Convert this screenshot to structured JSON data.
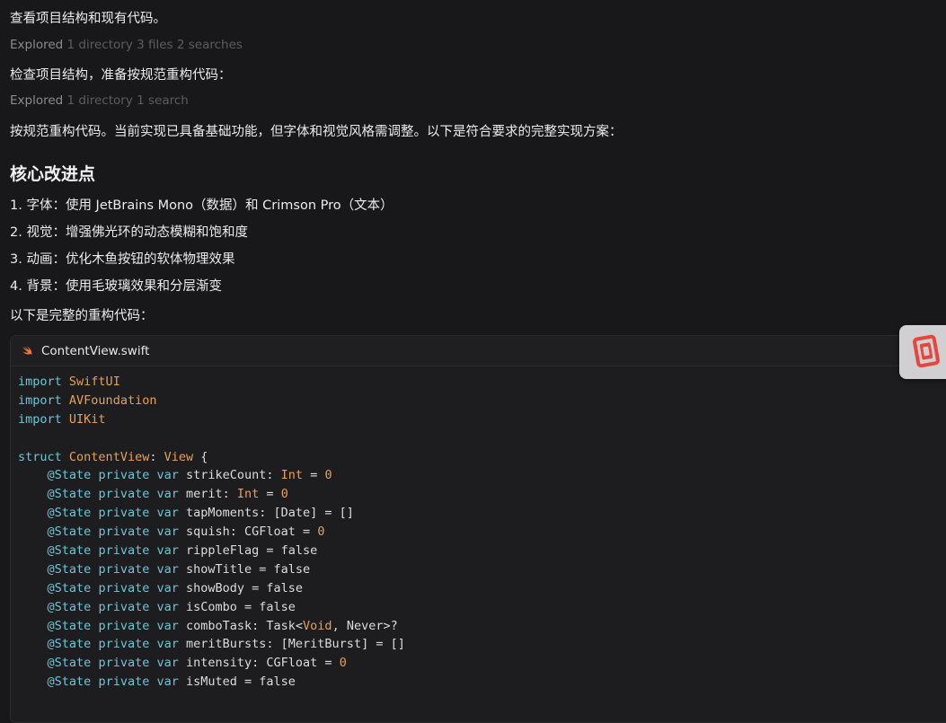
{
  "messages": {
    "p1": "查看项目结构和现有代码。",
    "explored1": {
      "verb": "Explored",
      "detail": "1 directory 3 files 2 searches"
    },
    "p2": "检查项目结构，准备按规范重构代码：",
    "explored2": {
      "verb": "Explored",
      "detail": "1 directory 1 search"
    },
    "p3": "按规范重构代码。当前实现已具备基础功能，但字体和视觉风格需调整。以下是符合要求的完整实现方案：",
    "heading": "核心改进点",
    "list": [
      "1. 字体：使用 JetBrains Mono（数据）和 Crimson Pro（文本）",
      "2. 视觉：增强佛光环的动态模糊和饱和度",
      "3. 动画：优化木鱼按钮的软体物理效果",
      "4. 背景：使用毛玻璃效果和分层渐变"
    ],
    "p4": "以下是完整的重构代码："
  },
  "code": {
    "filename": "ContentView.swift",
    "file_icon": "swift-icon",
    "lines": [
      [
        [
          "kw",
          "import"
        ],
        [
          "plain",
          " "
        ],
        [
          "type",
          "SwiftUI"
        ]
      ],
      [
        [
          "kw",
          "import"
        ],
        [
          "plain",
          " "
        ],
        [
          "type",
          "AVFoundation"
        ]
      ],
      [
        [
          "kw",
          "import"
        ],
        [
          "plain",
          " "
        ],
        [
          "type",
          "UIKit"
        ]
      ],
      [],
      [
        [
          "kw",
          "struct"
        ],
        [
          "plain",
          " "
        ],
        [
          "type",
          "ContentView"
        ],
        [
          "plain",
          ": "
        ],
        [
          "type",
          "View"
        ],
        [
          "plain",
          " {"
        ]
      ],
      [
        [
          "plain",
          "    "
        ],
        [
          "kw",
          "@State"
        ],
        [
          "plain",
          " "
        ],
        [
          "kw",
          "private"
        ],
        [
          "plain",
          " "
        ],
        [
          "kw",
          "var"
        ],
        [
          "plain",
          " strikeCount: "
        ],
        [
          "type",
          "Int"
        ],
        [
          "plain",
          " = "
        ],
        [
          "num",
          "0"
        ]
      ],
      [
        [
          "plain",
          "    "
        ],
        [
          "kw",
          "@State"
        ],
        [
          "plain",
          " "
        ],
        [
          "kw",
          "private"
        ],
        [
          "plain",
          " "
        ],
        [
          "kw",
          "var"
        ],
        [
          "plain",
          " merit: "
        ],
        [
          "type",
          "Int"
        ],
        [
          "plain",
          " = "
        ],
        [
          "num",
          "0"
        ]
      ],
      [
        [
          "plain",
          "    "
        ],
        [
          "kw",
          "@State"
        ],
        [
          "plain",
          " "
        ],
        [
          "kw",
          "private"
        ],
        [
          "plain",
          " "
        ],
        [
          "kw",
          "var"
        ],
        [
          "plain",
          " tapMoments: [Date] = []"
        ]
      ],
      [
        [
          "plain",
          "    "
        ],
        [
          "kw",
          "@State"
        ],
        [
          "plain",
          " "
        ],
        [
          "kw",
          "private"
        ],
        [
          "plain",
          " "
        ],
        [
          "kw",
          "var"
        ],
        [
          "plain",
          " squish: CGFloat = "
        ],
        [
          "num",
          "0"
        ]
      ],
      [
        [
          "plain",
          "    "
        ],
        [
          "kw",
          "@State"
        ],
        [
          "plain",
          " "
        ],
        [
          "kw",
          "private"
        ],
        [
          "plain",
          " "
        ],
        [
          "kw",
          "var"
        ],
        [
          "plain",
          " rippleFlag = false"
        ]
      ],
      [
        [
          "plain",
          "    "
        ],
        [
          "kw",
          "@State"
        ],
        [
          "plain",
          " "
        ],
        [
          "kw",
          "private"
        ],
        [
          "plain",
          " "
        ],
        [
          "kw",
          "var"
        ],
        [
          "plain",
          " showTitle = false"
        ]
      ],
      [
        [
          "plain",
          "    "
        ],
        [
          "kw",
          "@State"
        ],
        [
          "plain",
          " "
        ],
        [
          "kw",
          "private"
        ],
        [
          "plain",
          " "
        ],
        [
          "kw",
          "var"
        ],
        [
          "plain",
          " showBody = false"
        ]
      ],
      [
        [
          "plain",
          "    "
        ],
        [
          "kw",
          "@State"
        ],
        [
          "plain",
          " "
        ],
        [
          "kw",
          "private"
        ],
        [
          "plain",
          " "
        ],
        [
          "kw",
          "var"
        ],
        [
          "plain",
          " isCombo = false"
        ]
      ],
      [
        [
          "plain",
          "    "
        ],
        [
          "kw",
          "@State"
        ],
        [
          "plain",
          " "
        ],
        [
          "kw",
          "private"
        ],
        [
          "plain",
          " "
        ],
        [
          "kw",
          "var"
        ],
        [
          "plain",
          " comboTask: Task<"
        ],
        [
          "type",
          "Void"
        ],
        [
          "plain",
          ", Never>?"
        ]
      ],
      [
        [
          "plain",
          "    "
        ],
        [
          "kw",
          "@State"
        ],
        [
          "plain",
          " "
        ],
        [
          "kw",
          "private"
        ],
        [
          "plain",
          " "
        ],
        [
          "kw",
          "var"
        ],
        [
          "plain",
          " meritBursts: [MeritBurst] = []"
        ]
      ],
      [
        [
          "plain",
          "    "
        ],
        [
          "kw",
          "@State"
        ],
        [
          "plain",
          " "
        ],
        [
          "kw",
          "private"
        ],
        [
          "plain",
          " "
        ],
        [
          "kw",
          "var"
        ],
        [
          "plain",
          " intensity: CGFloat = "
        ],
        [
          "num",
          "0"
        ]
      ],
      [
        [
          "plain",
          "    "
        ],
        [
          "kw",
          "@State"
        ],
        [
          "plain",
          " "
        ],
        [
          "kw",
          "private"
        ],
        [
          "plain",
          " "
        ],
        [
          "kw",
          "var"
        ],
        [
          "plain",
          " isMuted = false"
        ]
      ]
    ]
  },
  "widget": {
    "icon": "app-logo-icon"
  },
  "colors": {
    "background": "#18181a",
    "keyword": "#6fc4d4",
    "type": "#e6a05a",
    "text": "#ececec",
    "muted": "#5d5d5d"
  }
}
